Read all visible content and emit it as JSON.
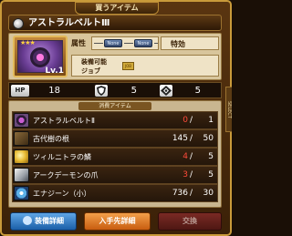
{
  "header": {
    "tab_label": "買うアイテム"
  },
  "item": {
    "name": "アストラルベルトⅢ",
    "level": "Lv.1",
    "stars": "★★★",
    "attr_label": "属性",
    "attr_none_1": "None",
    "attr_none_2": "None",
    "special_label": "特効",
    "equip_label": "装備可能 ジョブ",
    "job_badge": "JOB"
  },
  "stats": {
    "hp_label": "HP",
    "hp": "18",
    "defense": "5",
    "magic": "5"
  },
  "materials": {
    "header": "消費アイテム",
    "rows": [
      {
        "name": "アストラルベルトⅡ",
        "have": "0",
        "slash": "/",
        "need": "1",
        "have_color": "red",
        "icon": "belt-icon"
      },
      {
        "name": "古代樹の根",
        "have": "145",
        "slash": "/",
        "need": "50",
        "have_color": "white",
        "icon": "root-icon"
      },
      {
        "name": "ツィルニトラの鱗",
        "have": "4",
        "slash": "/",
        "need": "5",
        "have_color": "red",
        "icon": "scale-icon"
      },
      {
        "name": "アークデーモンの爪",
        "have": "3",
        "slash": "/",
        "need": "5",
        "have_color": "red",
        "icon": "claw-icon"
      },
      {
        "name": "エナジーン（小）",
        "have": "736",
        "slash": "/",
        "need": "30",
        "have_color": "white",
        "icon": "energy-icon"
      }
    ]
  },
  "side_tab": "SELECT",
  "buttons": {
    "detail": "装備詳細",
    "obtain": "入手先詳細",
    "exchange": "交換"
  },
  "colors": {
    "frame_gold": "#c99a3a",
    "deficit_red": "#ff4a3a",
    "detail_blue": "#1b5fa8",
    "obtain_orange": "#c85d10",
    "exchange_disabled": "#4e1713"
  }
}
